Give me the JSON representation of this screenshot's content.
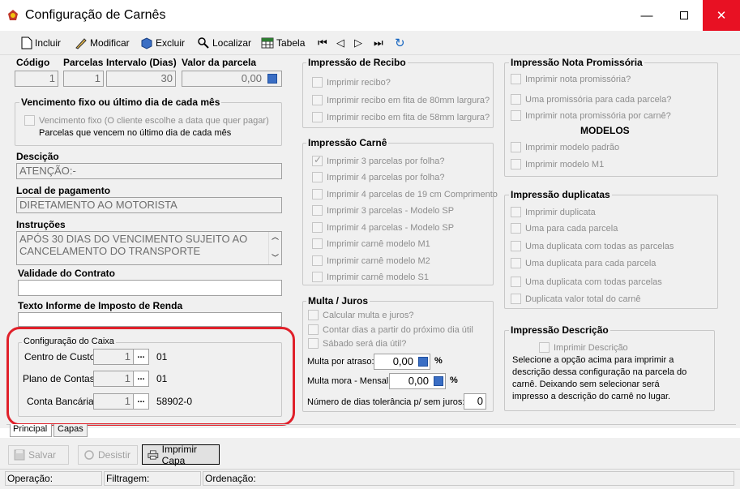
{
  "window": {
    "title": "Configuração de Carnês"
  },
  "toolbar": {
    "incluir": "Incluir",
    "modificar": "Modificar",
    "excluir": "Excluir",
    "localizar": "Localizar",
    "tabela": "Tabela"
  },
  "fields": {
    "codigo_label": "Código",
    "codigo_value": "1",
    "parcelas_label": "Parcelas",
    "parcelas_value": "1",
    "intervalo_label": "Intervalo (Dias)",
    "intervalo_value": "30",
    "valor_label": "Valor da parcela",
    "valor_value": "0,00"
  },
  "vencimento": {
    "title": "Vencimento fixo ou último dia de cada mês",
    "fixo": "Vencimento fixo (O cliente escolhe a data que quer pagar)",
    "ultimo": "Parcelas que vencem no último dia de cada mês"
  },
  "descricao": {
    "label": "Descição",
    "value": "ATENÇÃO:-"
  },
  "local": {
    "label": "Local de pagamento",
    "value": "DIRETAMENTO AO MOTORISTA"
  },
  "instrucoes": {
    "label": "Instruções",
    "line1": "APÓS 30 DIAS DO  VENCIMENTO SUJEITO AO",
    "line2": "CANCELAMENTO DO TRANSPORTE"
  },
  "validade": {
    "label": "Validade do Contrato",
    "value": ""
  },
  "texto_informe": {
    "label": "Texto Informe de Imposto de Renda",
    "value": ""
  },
  "caixa": {
    "title": "Configuração do Caixa",
    "centro_label": "Centro de Custo:",
    "centro_value": "1",
    "centro_code": "01",
    "plano_label": "Plano de Contas:",
    "plano_value": "1",
    "plano_code": "01",
    "conta_label": "Conta Bancária:",
    "conta_value": "1",
    "conta_code": "58902-0",
    "dots": "..."
  },
  "recibo": {
    "title": "Impressão de Recibo",
    "items": [
      "Imprimir recibo?",
      "Imprimir recibo em fita de 80mm largura?",
      "Imprimir recibo em fita de 58mm largura?"
    ]
  },
  "carne": {
    "title": "Impressão Carnê",
    "items": [
      "Imprimir 3 parcelas por folha?",
      "Imprimir 4 parcelas por folha?",
      "Imprimir 4 parcelas de 19 cm Comprimento",
      "Imprimir 3 parcelas - Modelo SP",
      "Imprimir 4 parcelas - Modelo SP",
      "Imprimir carnê modelo M1",
      "Imprimir carnê modelo M2",
      "Imprimir carnê modelo S1"
    ]
  },
  "multa": {
    "title": "Multa / Juros",
    "items": [
      "Calcular multa e juros?",
      "Contar dias a partir do próximo dia útil",
      "Sábado será dia útil?"
    ],
    "atraso_label": "Multa por atraso:",
    "atraso_value": "0,00",
    "mora_label": "Multa mora - Mensal:",
    "mora_value": "0,00",
    "tolerancia_label": "Número de dias tolerância p/ sem juros:",
    "tolerancia_value": "0",
    "percent": "%"
  },
  "promissoria": {
    "title": "Impressão Nota Promissória",
    "items": [
      "Imprimir nota promissória?",
      "Uma promissória para cada parcela?",
      "Imprimir nota promissória por carnê?"
    ],
    "modelos_title": "MODELOS",
    "modelos": [
      "Imprimir modelo padrão",
      "Imprimir modelo M1"
    ]
  },
  "duplicatas": {
    "title": "Impressão duplicatas",
    "items": [
      "Imprimir duplicata",
      "Uma para cada parcela",
      "Uma duplicata com todas as parcelas",
      "Uma duplicata para cada parcela",
      "Uma duplicata com todas parcelas",
      "Duplicata valor total do carnê"
    ]
  },
  "imp_descricao": {
    "title": "Impressão Descrição",
    "item": "Imprimir Descrição",
    "text": "Selecione a opção acima para imprimir  a descrição dessa configuração na parcela do carnê. Deixando sem selecionar será impresso a descrição do carnê no lugar."
  },
  "tabs": {
    "principal": "Principal",
    "capas": "Capas"
  },
  "buttons": {
    "salvar": "Salvar",
    "desistir": "Desistir",
    "imprimir_capa": "Imprimir Capa"
  },
  "status": {
    "operacao": "Operação:",
    "filtragem": "Filtragem:",
    "ordenacao": "Ordenação:"
  },
  "colors": {
    "highlight": "#e0202a",
    "close": "#e81123"
  }
}
